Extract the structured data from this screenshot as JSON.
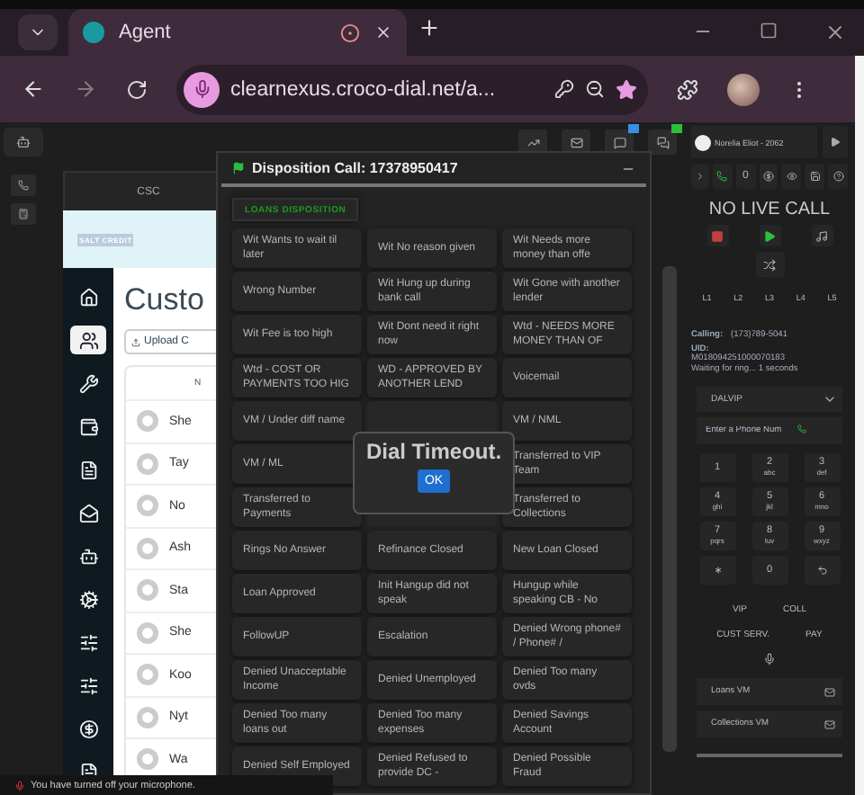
{
  "browser": {
    "tab_title": "Agent",
    "url": "clearnexus.croco-dial.net/a..."
  },
  "app_tab": "CSC",
  "embedded_page": {
    "logo": "SALT CREDIT",
    "heading": "Custo",
    "upload_button": "Upload C",
    "table_header": "N",
    "rows": [
      "She",
      "Tay",
      "No",
      "Ash",
      "Sta",
      "She",
      "Koo",
      "Nyt",
      "Wa"
    ]
  },
  "disposition": {
    "title": "Disposition Call: 17378950417",
    "tab": {
      "label": "LOANS DISPOSITION",
      "selected": true
    },
    "buttons": [
      {
        "kind": "button",
        "label": "Wit Wants to wait til later"
      },
      {
        "kind": "button",
        "label": "Wit No reason given"
      },
      {
        "kind": "button",
        "label": "Wit Needs more money than offe"
      },
      {
        "kind": "button",
        "label": "Wrong Number"
      },
      {
        "kind": "button",
        "label": "Wit Hung up during bank call"
      },
      {
        "kind": "button",
        "label": "Wit Gone with another lender"
      },
      {
        "kind": "button",
        "label": "Wit Fee is too high"
      },
      {
        "kind": "button",
        "label": "Wit Dont need it right now"
      },
      {
        "kind": "button",
        "label": "Wtd - NEEDS MORE MONEY THAN OF"
      },
      {
        "kind": "button",
        "label": "Wtd - COST OR PAYMENTS TOO HIG"
      },
      {
        "kind": "button",
        "label": "WD - APPROVED BY ANOTHER LEND"
      },
      {
        "kind": "button",
        "label": "Voicemail"
      },
      {
        "kind": "button",
        "label": "VM / Under diff name"
      },
      {
        "kind": "covered"
      },
      {
        "kind": "button",
        "label": "VM / NML"
      },
      {
        "kind": "button",
        "label": "VM / ML"
      },
      {
        "kind": "hidden"
      },
      {
        "kind": "button",
        "label": "Transferred to VIP Team"
      },
      {
        "kind": "button",
        "label": "Transferred to Payments"
      },
      {
        "kind": "covered"
      },
      {
        "kind": "button",
        "label": "Transferred to Collections"
      },
      {
        "kind": "button",
        "label": "Rings No Answer"
      },
      {
        "kind": "button",
        "label": "Refinance Closed"
      },
      {
        "kind": "button",
        "label": "New Loan Closed"
      },
      {
        "kind": "button",
        "label": "Loan Approved"
      },
      {
        "kind": "button",
        "label": "Init Hangup did not speak"
      },
      {
        "kind": "button",
        "label": "Hungup while speaking CB - No"
      },
      {
        "kind": "button",
        "label": "FollowUP"
      },
      {
        "kind": "button",
        "label": "Escalation"
      },
      {
        "kind": "button",
        "label": "Denied Wrong phone# / Phone# /"
      },
      {
        "kind": "button",
        "label": "Denied Unacceptable Income"
      },
      {
        "kind": "button",
        "label": "Denied Unemployed"
      },
      {
        "kind": "button",
        "label": "Denied Too many ovds"
      },
      {
        "kind": "button",
        "label": "Denied Too many loans out"
      },
      {
        "kind": "button",
        "label": "Denied Too many expenses"
      },
      {
        "kind": "button",
        "label": "Denied Savings Account"
      },
      {
        "kind": "button",
        "label": "Denied Self Employed"
      },
      {
        "kind": "button",
        "label": "Denied Refused to provide DC -"
      },
      {
        "kind": "button",
        "label": "Denied Possible Fraud"
      }
    ]
  },
  "alert": {
    "message": "Dial Timeout.",
    "button": "OK"
  },
  "agent_panel": {
    "agent": "Norelia Eliot - 2062",
    "counter": "0",
    "status": "NO LIVE CALL",
    "lines": [
      "L1",
      "L2",
      "L3",
      "L4",
      "L5"
    ],
    "calling_label": "Calling:",
    "calling_number": "(173)789-5041",
    "uid_label": "UID:",
    "uid": "M018094251000070183",
    "waiting": "Waiting for ring... 1 seconds",
    "campaign": "DALVIP",
    "phone_placeholder": "Enter a Phone Num",
    "keypad": [
      {
        "kind": "digit",
        "digit": "1"
      },
      {
        "kind": "digit",
        "digit": "2",
        "letters": "abc"
      },
      {
        "kind": "digit",
        "digit": "3",
        "letters": "def"
      },
      {
        "kind": "digit",
        "digit": "4",
        "letters": "ghi"
      },
      {
        "kind": "digit",
        "digit": "5",
        "letters": "jkl"
      },
      {
        "kind": "digit",
        "digit": "6",
        "letters": "mno"
      },
      {
        "kind": "digit",
        "digit": "7",
        "letters": "pqrs"
      },
      {
        "kind": "digit",
        "digit": "8",
        "letters": "tuv"
      },
      {
        "kind": "digit",
        "digit": "9",
        "letters": "wxyz"
      },
      {
        "kind": "star"
      },
      {
        "kind": "digit",
        "digit": "0"
      },
      {
        "kind": "redo"
      }
    ],
    "queues": [
      "VIP",
      "COLL",
      "CUST SERV.",
      "PAY"
    ],
    "voicemails": [
      "Loans VM",
      "Collections VM"
    ]
  },
  "toast": "You have turned off your microphone."
}
